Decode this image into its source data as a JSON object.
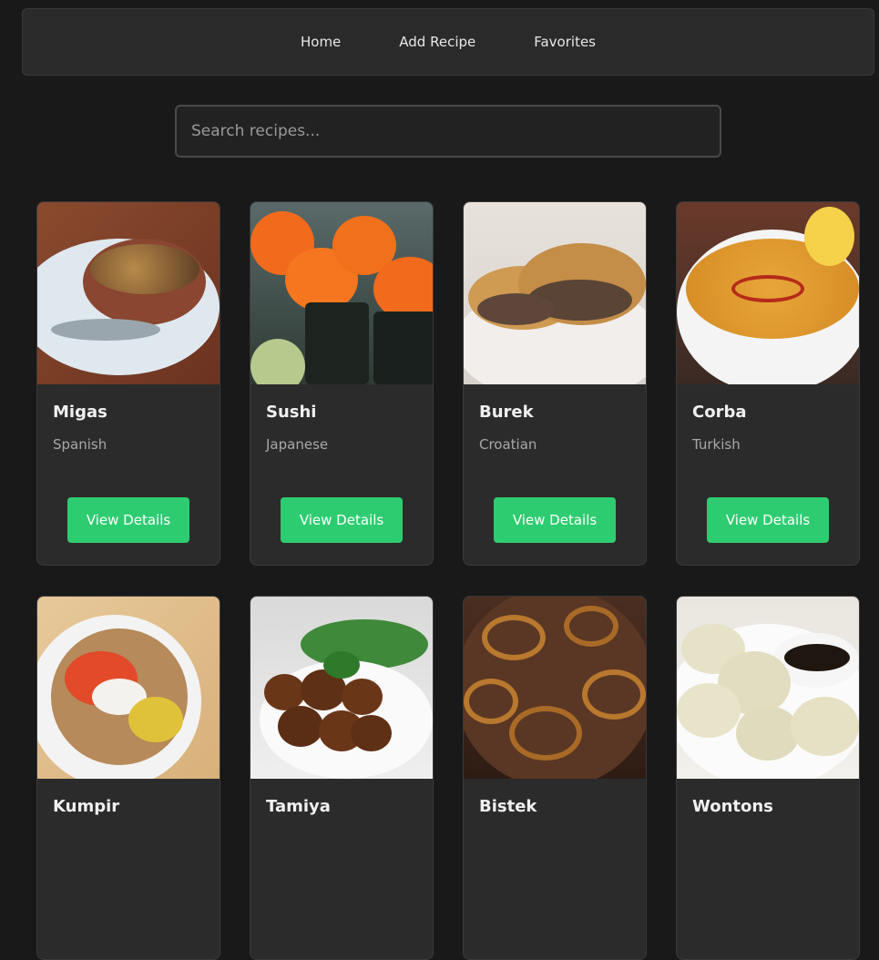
{
  "nav": {
    "home": "Home",
    "add_recipe": "Add Recipe",
    "favorites": "Favorites"
  },
  "search": {
    "placeholder": "Search recipes..."
  },
  "button_label": "View Details",
  "accent_color": "#2ecc71",
  "recipes": [
    {
      "name": "Migas",
      "cuisine": "Spanish"
    },
    {
      "name": "Sushi",
      "cuisine": "Japanese"
    },
    {
      "name": "Burek",
      "cuisine": "Croatian"
    },
    {
      "name": "Corba",
      "cuisine": "Turkish"
    },
    {
      "name": "Kumpir",
      "cuisine": ""
    },
    {
      "name": "Tamiya",
      "cuisine": ""
    },
    {
      "name": "Bistek",
      "cuisine": ""
    },
    {
      "name": "Wontons",
      "cuisine": ""
    }
  ]
}
